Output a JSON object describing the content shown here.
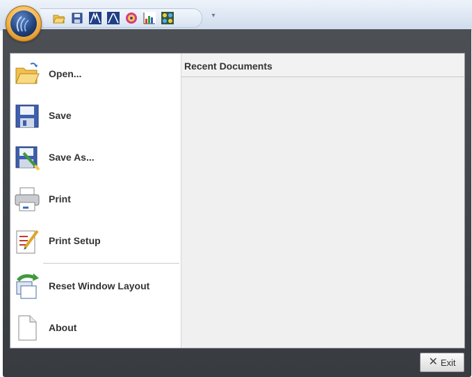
{
  "quick_access": {
    "buttons": [
      "open-icon",
      "save-icon",
      "peak-icon",
      "peak-alt-icon",
      "target-icon",
      "spectrum-icon",
      "grid-icon"
    ],
    "more_glyph": "▾"
  },
  "menu": {
    "items": [
      {
        "label": "Open...",
        "icon": "folder-open-icon"
      },
      {
        "label": "Save",
        "icon": "floppy-disk-icon"
      },
      {
        "label": "Save As...",
        "icon": "save-as-icon"
      },
      {
        "label": "Print",
        "icon": "printer-icon"
      },
      {
        "label": "Print Setup",
        "icon": "print-setup-icon"
      },
      {
        "label": "Reset Window Layout",
        "icon": "reset-layout-icon"
      },
      {
        "label": "About",
        "icon": "document-icon"
      }
    ]
  },
  "recent": {
    "title": "Recent Documents"
  },
  "footer": {
    "exit_label": "Exit",
    "exit_glyph": "✕"
  }
}
